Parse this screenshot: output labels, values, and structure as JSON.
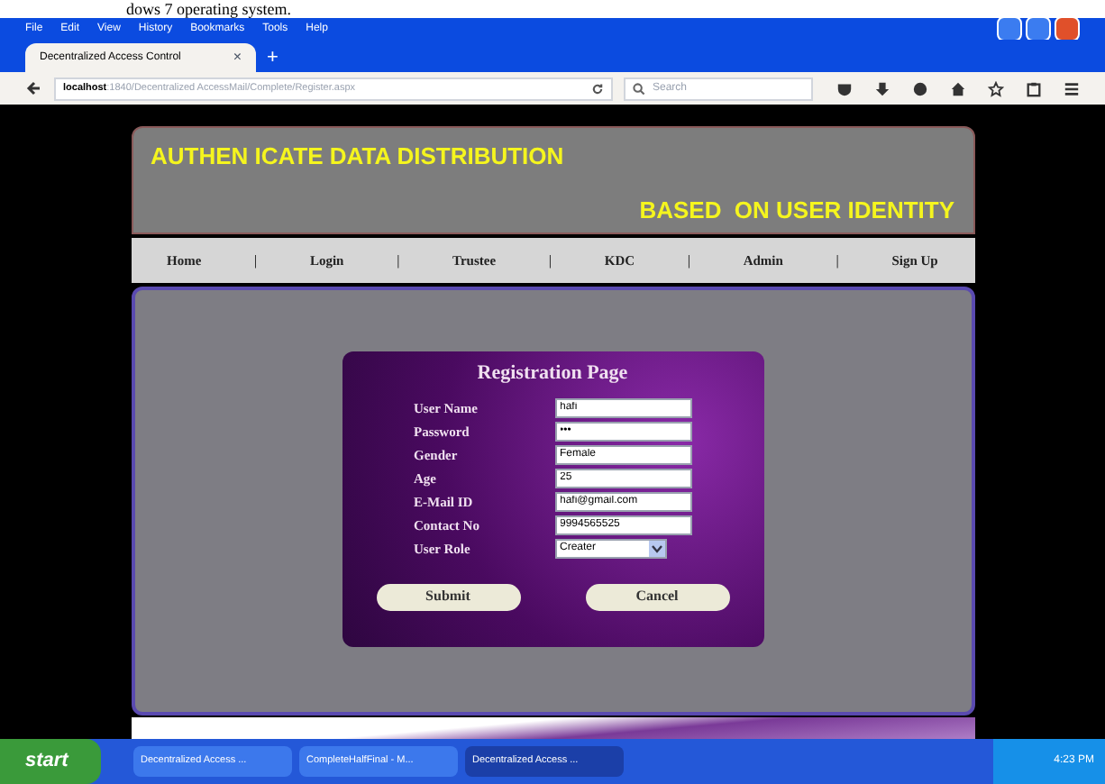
{
  "document_fragment": "dows 7 operating system.",
  "menu_bar": [
    "File",
    "Edit",
    "View",
    "History",
    "Bookmarks",
    "Tools",
    "Help"
  ],
  "tabs": [
    {
      "label": "Decentralized Access Control",
      "selected": true,
      "close": "×"
    }
  ],
  "new_tab": "+",
  "address_bar": {
    "host": "localhost",
    "path": ":1840/Decentralized AccessMail/Complete/Register.aspx"
  },
  "search": {
    "placeholder": "Search"
  },
  "header": {
    "line_1": "AUTHEN ICATE DATA DISTRIBUTION",
    "line_2": "BASED  ON USER IDENTITY"
  },
  "nav": [
    "Home",
    "Login",
    "Trustee",
    "KDC",
    "Admin",
    "Sign Up"
  ],
  "nav_separator": "|",
  "form": {
    "title": "Registration Page",
    "fields": [
      {
        "label": "User Name",
        "kind": "text",
        "value": "hafi"
      },
      {
        "label": "Password",
        "kind": "text",
        "value": "•••"
      },
      {
        "label": "Gender",
        "kind": "text",
        "value": "Female"
      },
      {
        "label": "Age",
        "kind": "text",
        "value": "25"
      },
      {
        "label": "E-Mail ID",
        "kind": "text",
        "value": "hafi@gmail.com"
      },
      {
        "label": "Contact No",
        "kind": "text",
        "value": "9994565525"
      },
      {
        "label": "User Role",
        "kind": "select",
        "value": "Creater"
      }
    ],
    "buttons": [
      "Submit",
      "Cancel"
    ]
  },
  "taskbar": {
    "start": "start",
    "items": [
      "Decentralized Access ...",
      "CompleteHalfFinal - M...",
      "Decentralized Access ..."
    ],
    "clock": "4:23 PM"
  }
}
